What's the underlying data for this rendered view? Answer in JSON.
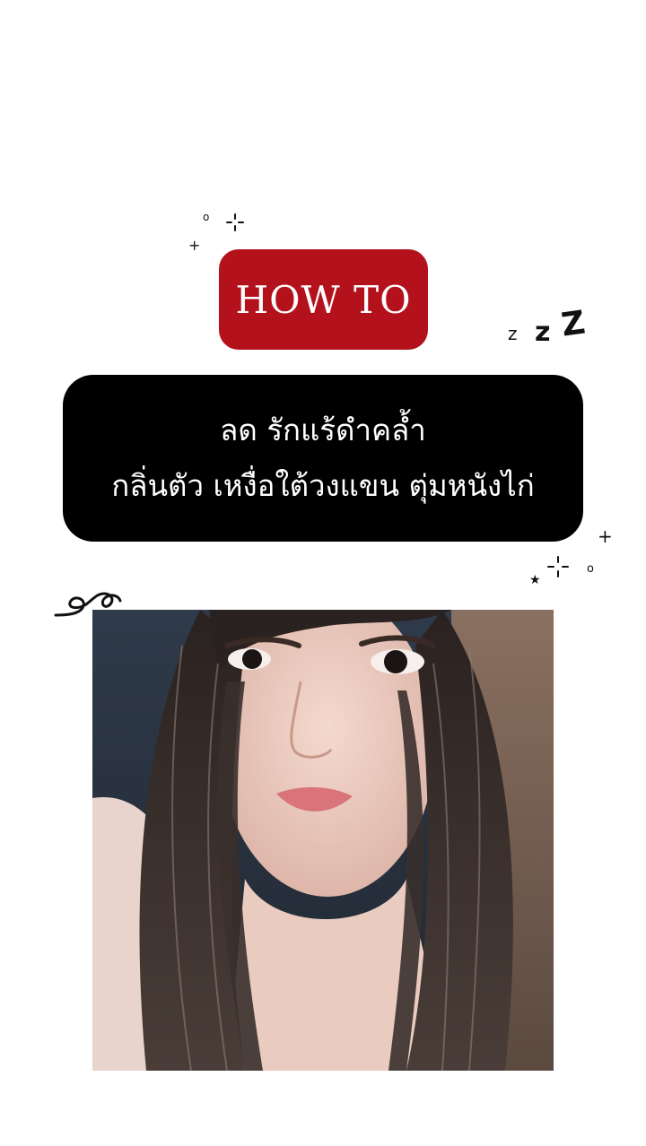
{
  "header": {
    "badge_label": "HOW TO"
  },
  "banner": {
    "line1": "ลด รักแร้ดำคล้ำ",
    "line2": "กลิ่นตัว เหงื่อใต้วงแขน ตุ่มหนังไก่"
  },
  "decorations": {
    "zzz_small": "z",
    "zzz_mid": "z",
    "zzz_large": "Z"
  },
  "colors": {
    "badge_bg": "#b3121d",
    "banner_bg": "#000000",
    "text_light": "#ffffff",
    "page_bg": "#ffffff"
  },
  "icons": [
    "sparkle-icon",
    "zzz-icon",
    "swirl-doodle-icon"
  ]
}
